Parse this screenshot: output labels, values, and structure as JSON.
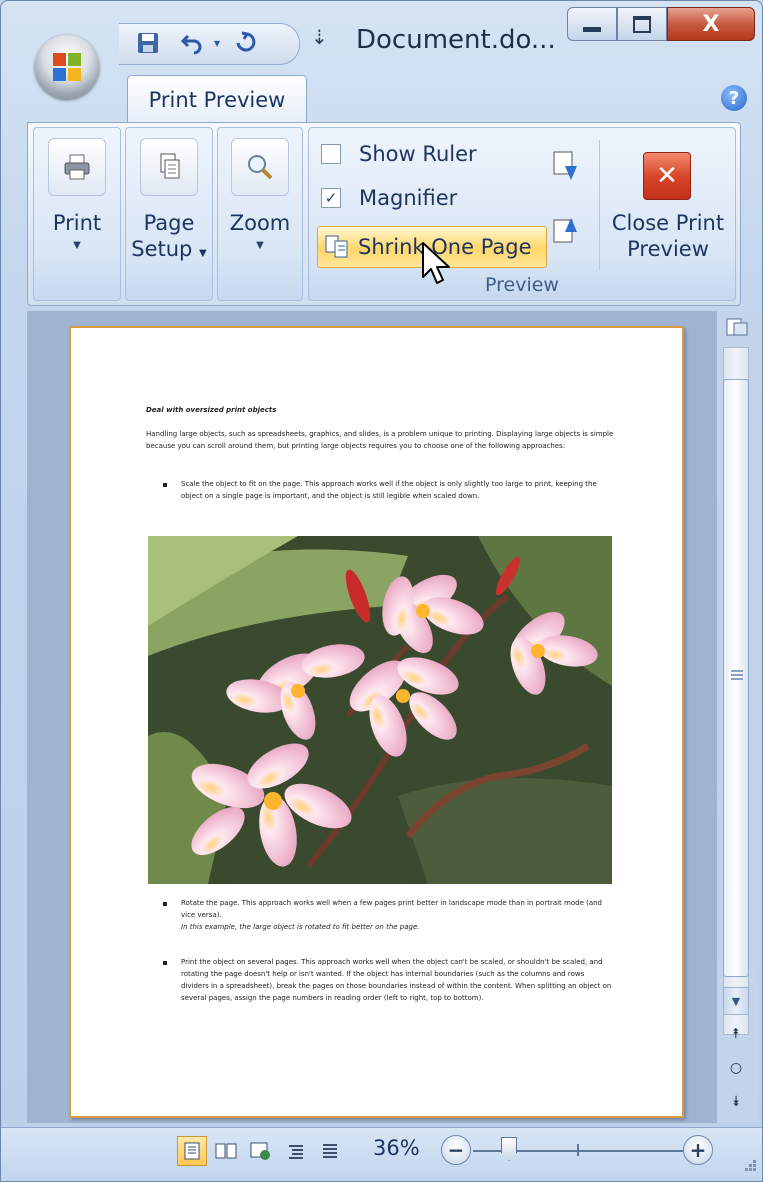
{
  "window": {
    "title": "Document.do...",
    "minimize_icon": "minimize-icon",
    "maximize_icon": "maximize-icon",
    "close_label": "X"
  },
  "ribbon": {
    "tab_label": "Print Preview",
    "help_label": "?",
    "print_group": {
      "print_label": "Print",
      "page_setup_line1": "Page",
      "page_setup_line2": "Setup",
      "zoom_label": "Zoom"
    },
    "preview_group": {
      "show_ruler_label": "Show Ruler",
      "show_ruler_checked": false,
      "magnifier_label": "Magnifier",
      "magnifier_checked": true,
      "shrink_label": "Shrink One Page",
      "close_line1": "Close Print",
      "close_line2": "Preview",
      "group_label": "Preview"
    }
  },
  "document": {
    "heading": "Deal with oversized print objects",
    "intro": "Handling large objects, such as spreadsheets, graphics, and slides, is a problem unique to printing. Displaying large objects is simple because you can scroll around them, but printing large objects requires you to choose one of the following approaches:",
    "bullet1": "Scale the object to fit on the page. This approach works well if the object is only slightly too large to print, keeping the object on a single page is important, and the object is still legible when scaled down.",
    "bullet2_line1": "Rotate the page. This approach works well when a few pages print better in landscape mode than in portrait mode (and vice versa).",
    "bullet2_line2": "In this example, the large object is rotated to fit better on the page.",
    "bullet3": "Print the object on several pages. This approach works well when the object can't be scaled, or shouldn't be scaled, and rotating the page doesn't help or isn't wanted. If the object has internal boundaries (such as the columns and rows dividers in a spreadsheet), break the pages on those boundaries instead of within the content. When splitting an object on several pages, assign the page numbers in reading order (left to right, top to bottom)."
  },
  "statusbar": {
    "zoom_percent": "36%",
    "zoom_out_label": "−",
    "zoom_in_label": "+",
    "zoom_level": 36
  },
  "colors": {
    "accent": "#1d3560",
    "page_border": "#d99a4a",
    "shrink_highlight": "#ffd76a",
    "close_red": "#d9472a"
  }
}
